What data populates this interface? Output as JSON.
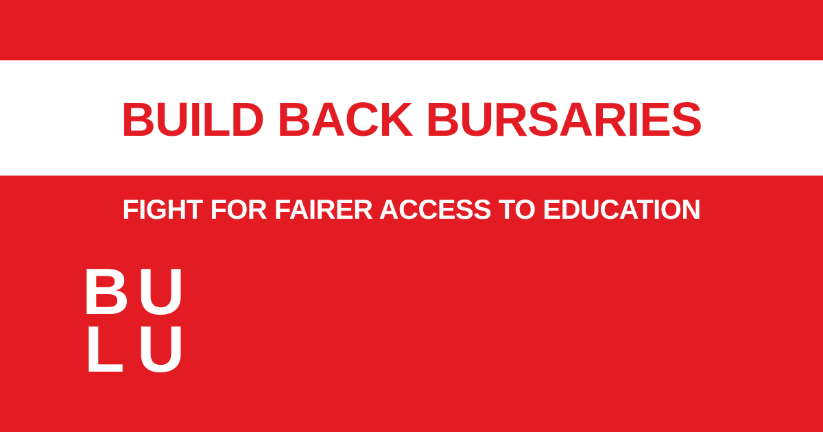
{
  "banner": {
    "background_color": "#e31b23",
    "title": "BUILD BACK BURSARIES",
    "title_color": "#e31b23",
    "title_band_color": "#ffffff",
    "tagline": "FIGHT FOR FAIRER ACCESS TO EDUCATION",
    "tagline_color": "#ffffff"
  },
  "logo": {
    "letters": [
      "B",
      "U",
      "L",
      "U"
    ],
    "color": "#ffffff"
  }
}
